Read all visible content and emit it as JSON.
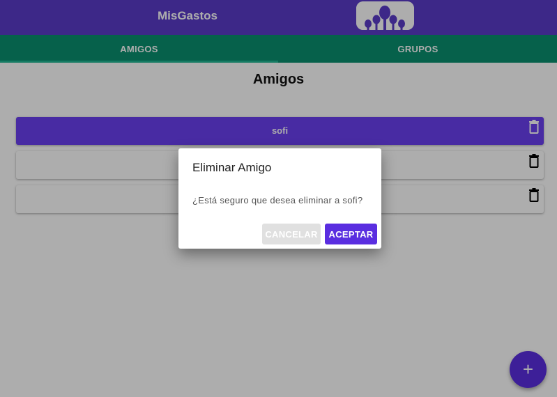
{
  "appbar": {
    "title": "MisGastos",
    "logo_icon": "people-group-icon",
    "color": "#5a3bc9"
  },
  "tabs": [
    {
      "label": "AMIGOS",
      "selected": true
    },
    {
      "label": "GRUPOS",
      "selected": false
    }
  ],
  "page": {
    "title": "Amigos"
  },
  "friends": [
    {
      "name": "sofi",
      "highlighted": true
    },
    {
      "name": "",
      "highlighted": false
    },
    {
      "name": "",
      "highlighted": false
    }
  ],
  "fab": {
    "label": "+",
    "icon": "plus-icon"
  },
  "dialog": {
    "title": "Eliminar Amigo",
    "message": "¿Está seguro que desea eliminar a sofi?",
    "cancel_label": "CANCELAR",
    "accept_label": "ACEPTAR"
  },
  "colors": {
    "accent": "#5a2ee0",
    "tabs": "#0a8f6f"
  }
}
